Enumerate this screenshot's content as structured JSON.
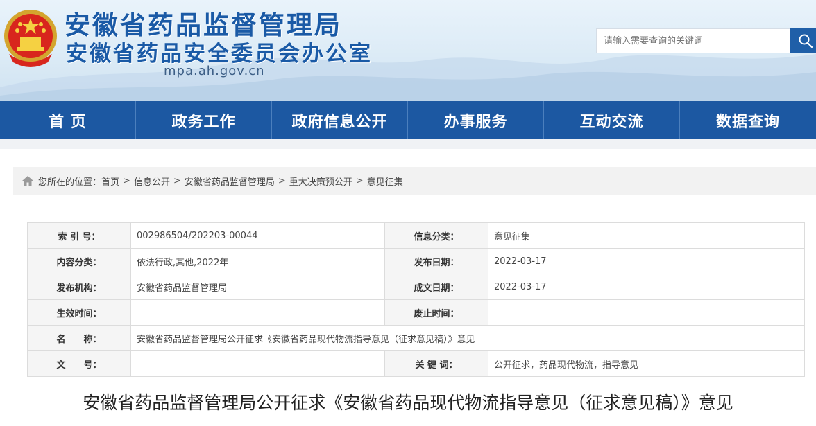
{
  "header": {
    "title_main": "安徽省药品监督管理局",
    "title_sub": "安徽省药品安全委员会办公室",
    "domain": "mpa.ah.gov.cn",
    "emblem_icon": "national-emblem-icon",
    "search": {
      "placeholder": "请输入需要查询的关键词",
      "icon": "search-icon"
    }
  },
  "nav": {
    "items": [
      {
        "label": "首 页"
      },
      {
        "label": "政务工作"
      },
      {
        "label": "政府信息公开"
      },
      {
        "label": "办事服务"
      },
      {
        "label": "互动交流"
      },
      {
        "label": "数据查询"
      }
    ]
  },
  "breadcrumb": {
    "prefix": "您所在的位置：",
    "separator": ">",
    "icon": "home-icon",
    "items": [
      "首页",
      "信息公开",
      "安徽省药品监督管理局",
      "重大决策预公开",
      "意见征集"
    ]
  },
  "info": {
    "index_label": "索 引 号：",
    "index_value": "002986504/202203-00044",
    "category_label": "信息分类：",
    "category_value": "意见征集",
    "content_label": "内容分类：",
    "content_value": "依法行政,其他,2022年",
    "publish_date_label": "发布日期：",
    "publish_date_value": "2022-03-17",
    "publisher_label": "发布机构：",
    "publisher_value": "安徽省药品监督管理局",
    "written_date_label": "成文日期：",
    "written_date_value": "2022-03-17",
    "effective_label": "生效时间：",
    "effective_value": "",
    "expire_label": "废止时间：",
    "expire_value": "",
    "name_label": "名　　称：",
    "name_value": "安徽省药品监督管理局公开征求《安徽省药品现代物流指导意见（征求意见稿）》意见",
    "docno_label": "文　　号：",
    "docno_value": "",
    "keywords_label": "关 键 词：",
    "keywords_value": "公开征求，药品现代物流，指导意见"
  },
  "article": {
    "title": "安徽省药品监督管理局公开征求《安徽省药品现代物流指导意见（征求意见稿）》意见"
  },
  "colors": {
    "brand_blue": "#1c58a2",
    "title_blue": "#1a5aa6",
    "search_button": "#1f5fa8"
  }
}
